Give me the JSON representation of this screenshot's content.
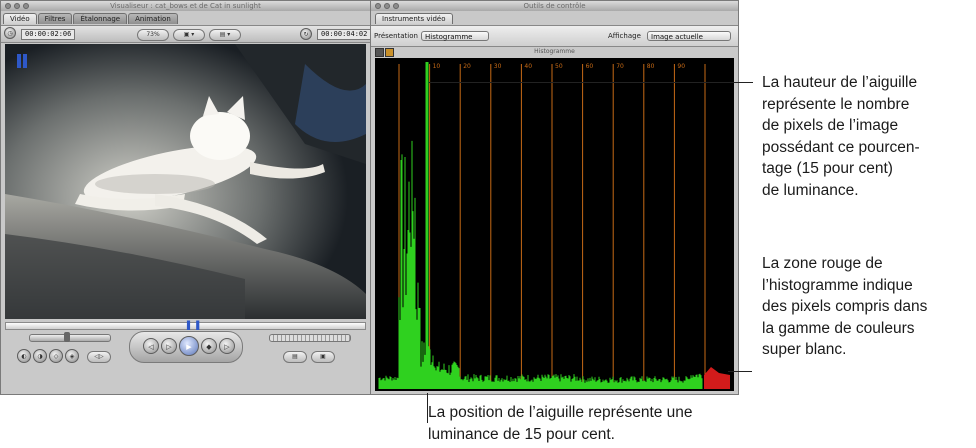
{
  "viewer": {
    "title": "Visualiseur : cat_bows et de Cat in sunlight",
    "tabs": [
      "Vidéo",
      "Filtres",
      "Étalonnage",
      "Animation"
    ],
    "timecode_left": "00:00:02:06",
    "timecode_right": "00:00:04:02",
    "zoom": "73%"
  },
  "scopes": {
    "title": "Outils de contrôle",
    "tab": "Instruments vidéo",
    "presentation_label": "Présentation",
    "presentation_value": "Histogramme",
    "display_label": "Affichage",
    "display_value": "Image actuelle",
    "graph_title": "Histogramme",
    "ticks": [
      "10",
      "20",
      "30",
      "40",
      "50",
      "60",
      "70",
      "80",
      "90"
    ]
  },
  "annotations": {
    "needle_height": [
      "La hauteur de l’aiguille",
      "représente le nombre",
      "de pixels de l’image",
      "possédant ce pourcen-",
      "tage (15 pour cent)",
      "de luminance."
    ],
    "red_zone": [
      "La zone rouge de",
      "l’histogramme indique",
      "des pixels compris dans",
      "la gamme de couleurs",
      "super blanc."
    ],
    "needle_position": [
      "La position de l’aiguille représente une",
      "luminance de 15 pour cent."
    ]
  },
  "colors": {
    "histogram_green": "#2fd11f",
    "superwhite_red": "#d21b1b",
    "gridline_orange": "#c66a16"
  }
}
